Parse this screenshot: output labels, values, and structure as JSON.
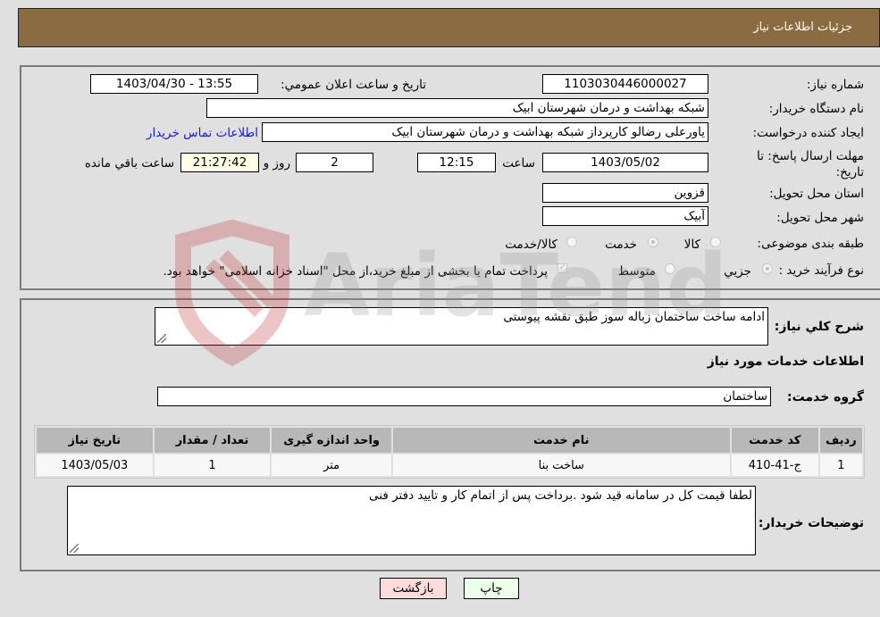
{
  "header": {
    "title": "جزئیات اطلاعات نیاز"
  },
  "form": {
    "need_number": {
      "label": "شماره نیاز:",
      "value": "1103030446000027"
    },
    "announce_datetime": {
      "label": "تاریخ و ساعت اعلان عمومي:",
      "value": "1403/04/30 - 13:55"
    },
    "buyer_org": {
      "label": "نام دستگاه خریدار:",
      "value": "شبکه بهداشت و درمان شهرستان ابیک"
    },
    "requester": {
      "label": "ایجاد کننده درخواست:",
      "value": "یاورعلی رضالو کارپرداز شبکه بهداشت و درمان شهرستان ابیک",
      "contact_link": "اطلاعات تماس خریدار"
    },
    "deadline": {
      "label": "مهلت ارسال پاسخ: تا تاریخ:",
      "date": "1403/05/02",
      "time_label": "ساعت",
      "time": "12:15",
      "days": "2",
      "days_label": "روز و",
      "remaining": "21:27:42",
      "remaining_label": "ساعت باقي مانده"
    },
    "delivery_province": {
      "label": "استان محل تحویل:",
      "value": "قزوین"
    },
    "delivery_city": {
      "label": "شهر محل تحویل:",
      "value": "آبیک"
    },
    "category": {
      "label": "طبقه بندی موضوعی:",
      "options": [
        {
          "label": "کالا",
          "checked": false
        },
        {
          "label": "خدمت",
          "checked": true
        },
        {
          "label": "کالا/خدمت",
          "checked": false
        }
      ]
    },
    "process_type": {
      "label": "نوع فرآیند خرید :",
      "options": [
        {
          "label": "جزيي",
          "checked": true
        },
        {
          "label": "متوسط",
          "checked": false
        }
      ],
      "payment_note": "پرداخت تمام یا بخشی از مبلغ خرید،از محل \"اسناد خزانه اسلامی\" خواهد بود.",
      "payment_checked": true
    }
  },
  "details": {
    "description_label": "شرح کلي نياز:",
    "description": "ادامه ساخت ساختمان زباله سوز طبق نقشه پیوستی",
    "services_title": "اطلاعات خدمات مورد نياز",
    "service_group_label": "گروه خدمت:",
    "service_group": "ساختمان",
    "table": {
      "headers": [
        "رديف",
        "کد خدمت",
        "نام خدمت",
        "واحد اندازه گیری",
        "تعداد / مقدار",
        "تاریخ نیاز"
      ],
      "rows": [
        [
          "1",
          "ج-41-410",
          "ساخت بنا",
          "متر",
          "1",
          "1403/05/03"
        ]
      ]
    },
    "buyer_notes_label": "توضیحات خریدار:",
    "buyer_notes": "لطفا قیمت کل در سامانه قید شود .برداخت پس از اتمام کار و تایید دفتر فنی"
  },
  "buttons": {
    "print": "چاپ",
    "back": "بازگشت"
  },
  "watermark": {
    "text": "AriaTender.neT"
  }
}
